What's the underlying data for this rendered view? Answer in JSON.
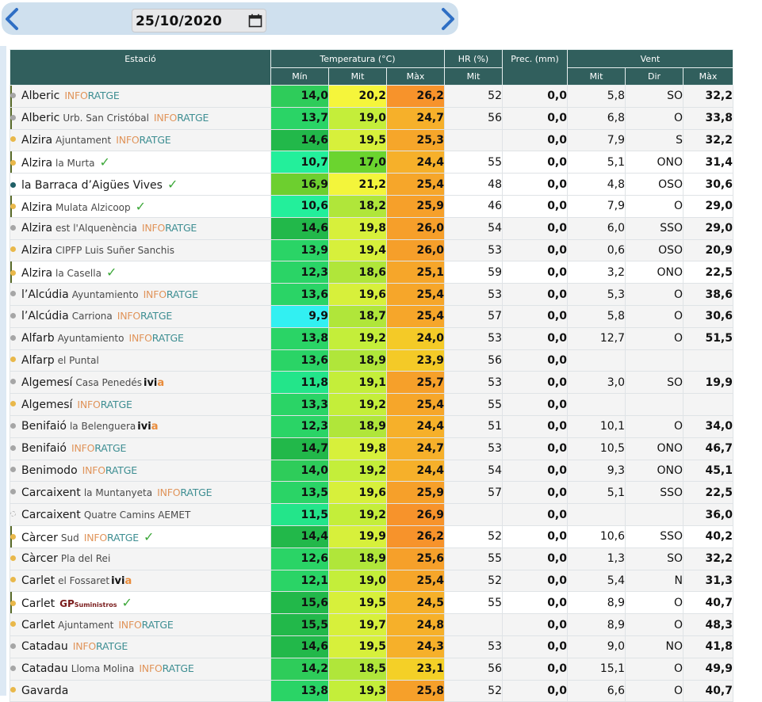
{
  "date": "25/10/2020",
  "icons": {
    "prev": "chevron-left-icon",
    "next": "chevron-right-icon",
    "calendar": "calendar-icon",
    "check": "check-icon"
  },
  "header": {
    "estacio": "Estació",
    "temperatura": "Temperatura (°C)",
    "hr": "HR (%)",
    "prec": "Prec. (mm)",
    "vent": "Vent",
    "min": "Mín",
    "mit": "Mit",
    "max": "Màx",
    "hr_mit": "Mit",
    "vent_mit": "Mit",
    "dir": "Dir",
    "vent_max": "Màx"
  },
  "colors": {
    "dot_gray": "#a6a6a6",
    "dot_yellow": "#e9b84a",
    "dot_dark": "#1f5f66",
    "header_bg": "#315f5d"
  },
  "rows": [
    {
      "name": "Alberic",
      "sub": "",
      "logo": "info",
      "check": false,
      "dot": "gray",
      "marked": true,
      "sel": false,
      "min": "14,0",
      "mit": "20,2",
      "max": "26,2",
      "hr": "52",
      "prec": "0,0",
      "vmit": "5,8",
      "dir": "SO",
      "vmax": "32,2",
      "cmin": "#2ecc5a",
      "cmit": "#f5f53b",
      "cmax": "#f7932b"
    },
    {
      "name": "Alberic",
      "sub": "Urb. San Cristóbal",
      "logo": "info",
      "check": false,
      "dot": "gray",
      "marked": true,
      "sel": false,
      "min": "13,7",
      "mit": "19,0",
      "max": "24,7",
      "hr": "56",
      "prec": "0,0",
      "vmit": "6,8",
      "dir": "O",
      "vmax": "33,8",
      "cmin": "#2ad466",
      "cmit": "#c4ee3a",
      "cmax": "#f6b02a"
    },
    {
      "name": "Alzira",
      "sub": "Ajuntament",
      "logo": "info",
      "check": false,
      "dot": "yellow",
      "marked": false,
      "sel": false,
      "min": "14,6",
      "mit": "19,5",
      "max": "25,3",
      "hr": "",
      "prec": "0,0",
      "vmit": "7,9",
      "dir": "S",
      "vmax": "32,2",
      "cmin": "#22b84a",
      "cmit": "#d7f03b",
      "cmax": "#f6a62a"
    },
    {
      "name": "Alzira",
      "sub": "la Murta",
      "logo": "",
      "check": true,
      "dot": "yellow",
      "marked": true,
      "sel": true,
      "min": "10,7",
      "mit": "17,0",
      "max": "24,4",
      "hr": "55",
      "prec": "0,0",
      "vmit": "5,1",
      "dir": "ONO",
      "vmax": "31,4",
      "cmin": "#23ef9b",
      "cmit": "#6bd42f",
      "cmax": "#f6b02a"
    },
    {
      "name": "la Barraca d’Aigües Vives",
      "sub": "",
      "logo": "",
      "check": true,
      "dot": "dark",
      "marked": false,
      "sel": true,
      "min": "16,9",
      "mit": "21,2",
      "max": "25,4",
      "hr": "48",
      "prec": "0,0",
      "vmit": "4,8",
      "dir": "OSO",
      "vmax": "30,6",
      "cmin": "#6dcf2f",
      "cmit": "#f3f53b",
      "cmax": "#f6a62a"
    },
    {
      "name": "Alzira",
      "sub": "Mulata Alzicoop",
      "logo": "",
      "check": true,
      "dot": "yellow",
      "marked": true,
      "sel": true,
      "min": "10,6",
      "mit": "18,2",
      "max": "25,9",
      "hr": "46",
      "prec": "0,0",
      "vmit": "7,9",
      "dir": "O",
      "vmax": "29,0",
      "cmin": "#23ef9b",
      "cmit": "#b0e63a",
      "cmax": "#f6a02a"
    },
    {
      "name": "Alzira",
      "sub": "est l'Alquenència",
      "logo": "info",
      "check": false,
      "dot": "gray",
      "marked": false,
      "sel": false,
      "min": "14,6",
      "mit": "19,8",
      "max": "26,0",
      "hr": "54",
      "prec": "0,0",
      "vmit": "6,0",
      "dir": "SSO",
      "vmax": "29,0",
      "cmin": "#22b84a",
      "cmit": "#d7f03b",
      "cmax": "#f69f2a"
    },
    {
      "name": "Alzira",
      "sub": "CIPFP Luis Suñer Sanchis",
      "logo": "",
      "check": false,
      "dot": "yellow",
      "marked": false,
      "sel": false,
      "min": "13,9",
      "mit": "19,4",
      "max": "26,0",
      "hr": "53",
      "prec": "0,0",
      "vmit": "0,6",
      "dir": "OSO",
      "vmax": "20,9",
      "cmin": "#2ad466",
      "cmit": "#d7f03b",
      "cmax": "#f69f2a"
    },
    {
      "name": "Alzira",
      "sub": "la Casella",
      "logo": "",
      "check": true,
      "dot": "yellow",
      "marked": true,
      "sel": true,
      "min": "12,3",
      "mit": "18,6",
      "max": "25,1",
      "hr": "59",
      "prec": "0,0",
      "vmit": "3,2",
      "dir": "ONO",
      "vmax": "22,5",
      "cmin": "#2ad466",
      "cmit": "#b0e63a",
      "cmax": "#f6a62a"
    },
    {
      "name": "l’Alcúdia",
      "sub": "Ayuntamiento",
      "logo": "info",
      "check": false,
      "dot": "gray",
      "marked": false,
      "sel": false,
      "min": "13,6",
      "mit": "19,6",
      "max": "25,4",
      "hr": "53",
      "prec": "0,0",
      "vmit": "5,3",
      "dir": "O",
      "vmax": "38,6",
      "cmin": "#2ad466",
      "cmit": "#d7f03b",
      "cmax": "#f6a62a"
    },
    {
      "name": "l’Alcúdia",
      "sub": "Carriona",
      "logo": "info",
      "check": false,
      "dot": "gray",
      "marked": false,
      "sel": false,
      "min": "9,9",
      "mit": "18,7",
      "max": "25,4",
      "hr": "57",
      "prec": "0,0",
      "vmit": "5,8",
      "dir": "O",
      "vmax": "30,6",
      "cmin": "#32f0f2",
      "cmit": "#b0e63a",
      "cmax": "#f6a62a"
    },
    {
      "name": "Alfarb",
      "sub": "Ayuntamiento",
      "logo": "info",
      "check": false,
      "dot": "gray",
      "marked": false,
      "sel": false,
      "min": "13,8",
      "mit": "19,2",
      "max": "24,0",
      "hr": "53",
      "prec": "0,0",
      "vmit": "12,7",
      "dir": "O",
      "vmax": "51,5",
      "cmin": "#2ad466",
      "cmit": "#c4ee3a",
      "cmax": "#f4ca27"
    },
    {
      "name": "Alfarp",
      "sub": "el Puntal",
      "logo": "",
      "check": false,
      "dot": "yellow",
      "marked": false,
      "sel": false,
      "min": "13,6",
      "mit": "18,9",
      "max": "23,9",
      "hr": "56",
      "prec": "0,0",
      "vmit": "",
      "dir": "",
      "vmax": "",
      "cmin": "#2ad466",
      "cmit": "#b0e63a",
      "cmax": "#f4ca27"
    },
    {
      "name": "Algemesí",
      "sub": "Casa Penedés",
      "logo": "ivia",
      "check": false,
      "dot": "gray",
      "marked": false,
      "sel": false,
      "min": "11,8",
      "mit": "19,1",
      "max": "25,7",
      "hr": "53",
      "prec": "0,0",
      "vmit": "3,0",
      "dir": "SO",
      "vmax": "19,9",
      "cmin": "#23e58a",
      "cmit": "#c4ee3a",
      "cmax": "#f6a02a"
    },
    {
      "name": "Algemesí",
      "sub": "",
      "logo": "info",
      "check": false,
      "dot": "yellow",
      "marked": false,
      "sel": false,
      "min": "13,3",
      "mit": "19,2",
      "max": "25,4",
      "hr": "55",
      "prec": "0,0",
      "vmit": "",
      "dir": "",
      "vmax": "",
      "cmin": "#2ad466",
      "cmit": "#c4ee3a",
      "cmax": "#f6a62a"
    },
    {
      "name": "Benifaió",
      "sub": "la Belenguera",
      "logo": "ivia",
      "check": false,
      "dot": "gray",
      "marked": false,
      "sel": false,
      "min": "12,3",
      "mit": "18,9",
      "max": "24,4",
      "hr": "51",
      "prec": "0,0",
      "vmit": "10,1",
      "dir": "O",
      "vmax": "34,0",
      "cmin": "#2ad466",
      "cmit": "#b0e63a",
      "cmax": "#f6b02a"
    },
    {
      "name": "Benifaió",
      "sub": "",
      "logo": "info",
      "check": false,
      "dot": "gray",
      "marked": false,
      "sel": false,
      "min": "14,7",
      "mit": "19,8",
      "max": "24,7",
      "hr": "53",
      "prec": "0,0",
      "vmit": "10,5",
      "dir": "ONO",
      "vmax": "46,7",
      "cmin": "#22b84a",
      "cmit": "#d7f03b",
      "cmax": "#f6b02a"
    },
    {
      "name": "Benimodo",
      "sub": "",
      "logo": "info",
      "check": false,
      "dot": "gray",
      "marked": false,
      "sel": false,
      "min": "14,0",
      "mit": "19,2",
      "max": "24,4",
      "hr": "54",
      "prec": "0,0",
      "vmit": "9,3",
      "dir": "ONO",
      "vmax": "45,1",
      "cmin": "#2ecc5a",
      "cmit": "#c4ee3a",
      "cmax": "#f6b02a"
    },
    {
      "name": "Carcaixent",
      "sub": "la Muntanyeta",
      "logo": "info",
      "check": false,
      "dot": "gray",
      "marked": false,
      "sel": false,
      "min": "13,5",
      "mit": "19,6",
      "max": "25,9",
      "hr": "57",
      "prec": "0,0",
      "vmit": "5,1",
      "dir": "SSO",
      "vmax": "22,5",
      "cmin": "#2ad466",
      "cmit": "#d7f03b",
      "cmax": "#f6a02a"
    },
    {
      "name": "Carcaixent",
      "sub": "Quatre Camins AEMET",
      "logo": "",
      "check": false,
      "dot": "none",
      "marked": false,
      "sel": false,
      "min": "11,5",
      "mit": "19,2",
      "max": "26,9",
      "hr": "",
      "prec": "0,0",
      "vmit": "",
      "dir": "",
      "vmax": "36,0",
      "cmin": "#23e58a",
      "cmit": "#c4ee3a",
      "cmax": "#f7932b"
    },
    {
      "name": "Càrcer",
      "sub": "Sud",
      "logo": "info",
      "check": true,
      "dot": "yellow",
      "marked": true,
      "sel": true,
      "min": "14,4",
      "mit": "19,9",
      "max": "26,2",
      "hr": "52",
      "prec": "0,0",
      "vmit": "10,6",
      "dir": "SSO",
      "vmax": "40,2",
      "cmin": "#22b84a",
      "cmit": "#d7f03b",
      "cmax": "#f7932b"
    },
    {
      "name": "Càrcer",
      "sub": "Pla del Rei",
      "logo": "",
      "check": false,
      "dot": "yellow",
      "marked": false,
      "sel": false,
      "min": "12,6",
      "mit": "18,9",
      "max": "25,6",
      "hr": "55",
      "prec": "0,0",
      "vmit": "1,3",
      "dir": "SO",
      "vmax": "32,2",
      "cmin": "#2ad466",
      "cmit": "#b0e63a",
      "cmax": "#f6a02a"
    },
    {
      "name": "Carlet",
      "sub": "el Fossaret",
      "logo": "ivia",
      "check": false,
      "dot": "yellow",
      "marked": false,
      "sel": false,
      "min": "12,1",
      "mit": "19,0",
      "max": "25,4",
      "hr": "52",
      "prec": "0,0",
      "vmit": "5,4",
      "dir": "N",
      "vmax": "31,3",
      "cmin": "#2ad466",
      "cmit": "#c4ee3a",
      "cmax": "#f6a62a"
    },
    {
      "name": "Carlet",
      "sub": "",
      "logo": "gp",
      "check": true,
      "dot": "yellow",
      "marked": true,
      "sel": true,
      "min": "15,6",
      "mit": "19,5",
      "max": "24,5",
      "hr": "55",
      "prec": "0,0",
      "vmit": "8,9",
      "dir": "O",
      "vmax": "40,7",
      "cmin": "#22b84a",
      "cmit": "#d7f03b",
      "cmax": "#f6b02a"
    },
    {
      "name": "Carlet",
      "sub": "Ajuntament",
      "logo": "info",
      "check": false,
      "dot": "yellow",
      "marked": false,
      "sel": false,
      "min": "15,5",
      "mit": "19,7",
      "max": "24,8",
      "hr": "",
      "prec": "0,0",
      "vmit": "8,9",
      "dir": "O",
      "vmax": "48,3",
      "cmin": "#22b84a",
      "cmit": "#d7f03b",
      "cmax": "#f6b02a"
    },
    {
      "name": "Catadau",
      "sub": "",
      "logo": "info",
      "check": false,
      "dot": "gray",
      "marked": false,
      "sel": false,
      "min": "14,6",
      "mit": "19,5",
      "max": "24,3",
      "hr": "53",
      "prec": "0,0",
      "vmit": "9,0",
      "dir": "NO",
      "vmax": "41,8",
      "cmin": "#22b84a",
      "cmit": "#d7f03b",
      "cmax": "#f6b02a"
    },
    {
      "name": "Catadau",
      "sub": "Lloma Molina",
      "logo": "info",
      "check": false,
      "dot": "gray",
      "marked": false,
      "sel": false,
      "min": "14,2",
      "mit": "18,5",
      "max": "23,1",
      "hr": "56",
      "prec": "0,0",
      "vmit": "15,1",
      "dir": "O",
      "vmax": "49,9",
      "cmin": "#2ecc5a",
      "cmit": "#b0e63a",
      "cmax": "#f4d027"
    },
    {
      "name": "Gavarda",
      "sub": "",
      "logo": "",
      "check": false,
      "dot": "yellow",
      "marked": false,
      "sel": false,
      "min": "13,8",
      "mit": "19,3",
      "max": "25,8",
      "hr": "52",
      "prec": "0,0",
      "vmit": "6,6",
      "dir": "O",
      "vmax": "40,7",
      "cmin": "#2ad466",
      "cmit": "#c4ee3a",
      "cmax": "#f6a02a"
    }
  ],
  "logos": {
    "info_a": "INFO",
    "info_b": "RATGE",
    "ivia_a": "ivi",
    "ivia_b": "a",
    "gp_a": "GP",
    "gp_b": "Suministros",
    "check": "✓"
  }
}
